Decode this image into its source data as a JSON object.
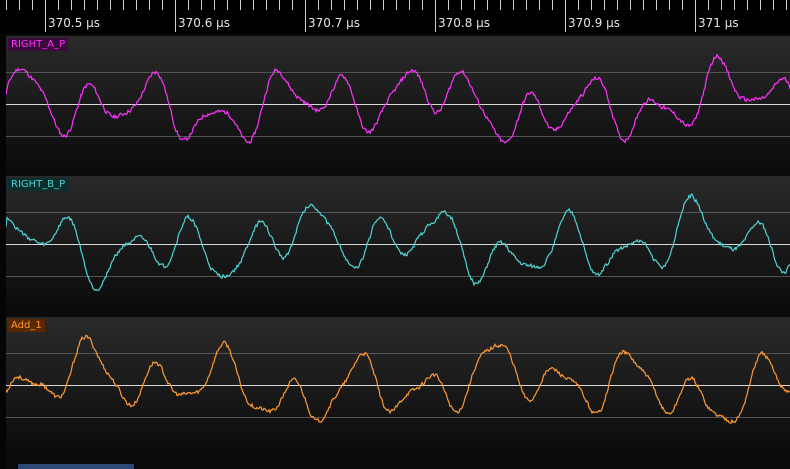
{
  "ruler": {
    "ticks": [
      "370.5 µs",
      "370.6 µs",
      "370.7 µs",
      "370.8 µs",
      "370.9 µs",
      "371 µs"
    ]
  },
  "channels": [
    {
      "name": "RIGHT_A_P",
      "color": "#ff33ff",
      "seed": 11
    },
    {
      "name": "RIGHT_B_P",
      "color": "#4fd4d4",
      "seed": 27
    },
    {
      "name": "Add_1",
      "color": "#ff9933",
      "seed": 53
    }
  ]
}
